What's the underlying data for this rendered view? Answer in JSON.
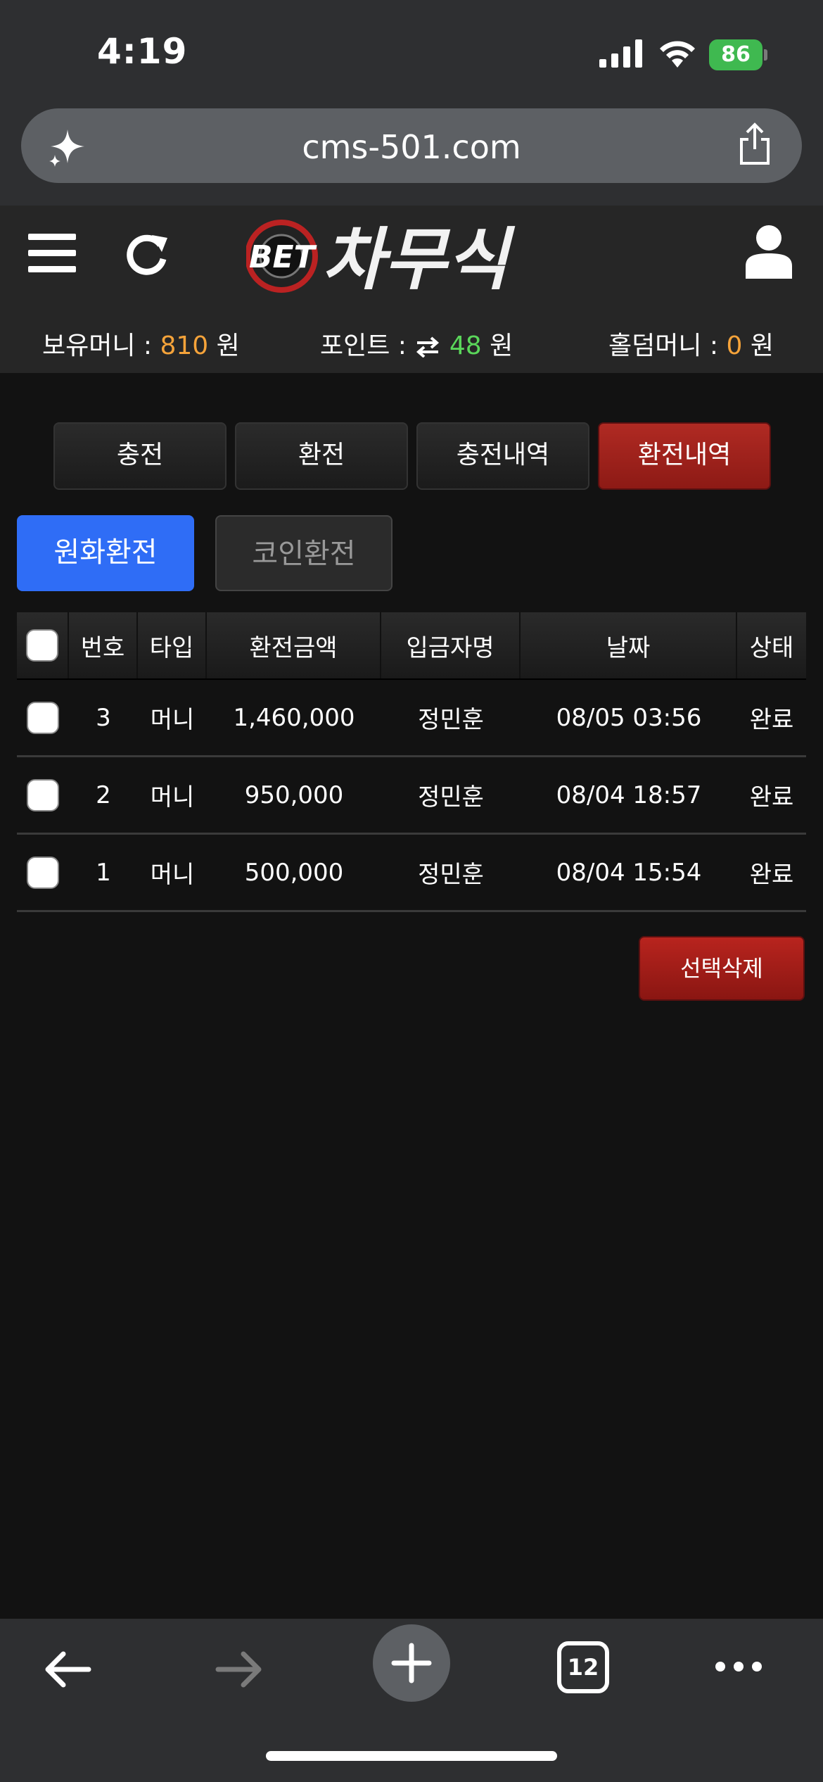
{
  "status_bar": {
    "time": "4:19",
    "battery": "86"
  },
  "browser": {
    "url": "cms-501.com"
  },
  "header": {
    "logo_text": "BET 차무식",
    "balance_label": "보유머니 : ",
    "balance_value": "810",
    "points_label": "포인트 : ",
    "points_value": "48",
    "holdem_label": "홀덤머니 : ",
    "holdem_value": "0",
    "currency": "원"
  },
  "tabs": [
    {
      "label": "충전",
      "active": false
    },
    {
      "label": "환전",
      "active": false
    },
    {
      "label": "충전내역",
      "active": false
    },
    {
      "label": "환전내역",
      "active": true
    }
  ],
  "subtabs": [
    {
      "label": "원화환전",
      "active": true
    },
    {
      "label": "코인환전",
      "active": false
    }
  ],
  "table": {
    "headers": [
      "번호",
      "타입",
      "환전금액",
      "입금자명",
      "날짜",
      "상태"
    ],
    "rows": [
      {
        "no": "3",
        "type": "머니",
        "amount": "1,460,000",
        "name": "정민훈",
        "date": "08/05 03:56",
        "status": "완료"
      },
      {
        "no": "2",
        "type": "머니",
        "amount": "950,000",
        "name": "정민훈",
        "date": "08/04 18:57",
        "status": "완료"
      },
      {
        "no": "1",
        "type": "머니",
        "amount": "500,000",
        "name": "정민훈",
        "date": "08/04 15:54",
        "status": "완료"
      }
    ]
  },
  "actions": {
    "delete_label": "선택삭제"
  },
  "bottom_bar": {
    "tab_count": "12"
  },
  "colors": {
    "accent_red": "#9e211b",
    "primary_blue": "#2f6df6",
    "orange": "#f5a33a",
    "green": "#5ad65a"
  }
}
